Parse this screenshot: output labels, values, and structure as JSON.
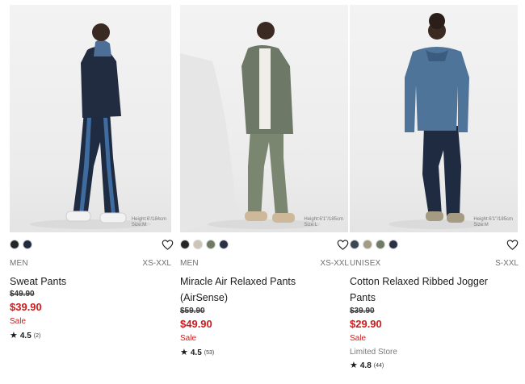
{
  "products": [
    {
      "photo_caption_height": "Height:6'/184cm",
      "photo_caption_size": "Size:M",
      "swatches": [
        "#252628",
        "#1f2b40"
      ],
      "gender": "MEN",
      "size_range": "XS-XXL",
      "name": "Sweat Pants",
      "original_price": "$49.90",
      "price": "$39.90",
      "sale_label": "Sale",
      "store_label": "",
      "rating": "4.5",
      "review_count": "(2)"
    },
    {
      "photo_caption_height": "Height:6'1\"/185cm",
      "photo_caption_size": "Size:L",
      "swatches": [
        "#252628",
        "#cdc4b8",
        "#6f7a62",
        "#2a3147"
      ],
      "gender": "MEN",
      "size_range": "XS-XXL",
      "name": "Miracle Air Relaxed Pants (AirSense)",
      "original_price": "$59.90",
      "price": "$49.90",
      "sale_label": "Sale",
      "store_label": "",
      "rating": "4.5",
      "review_count": "(53)"
    },
    {
      "photo_caption_height": "Height:6'1\"/185cm",
      "photo_caption_size": "Size:M",
      "swatches": [
        "#3b4654",
        "#a39c84",
        "#6f7a62",
        "#2a3147"
      ],
      "gender": "UNISEX",
      "size_range": "S-XXL",
      "name": "Cotton Relaxed Ribbed Jogger Pants",
      "original_price": "$39.90",
      "price": "$29.90",
      "sale_label": "Sale",
      "store_label": "Limited Store",
      "rating": "4.8",
      "review_count": "(44)"
    }
  ],
  "icons": {
    "favorite": "heart-outline-icon",
    "rating": "star-icon"
  },
  "colors": {
    "sale_red": "#cd1b1b",
    "text": "#1b1b1b",
    "muted": "#6f6f6f"
  }
}
